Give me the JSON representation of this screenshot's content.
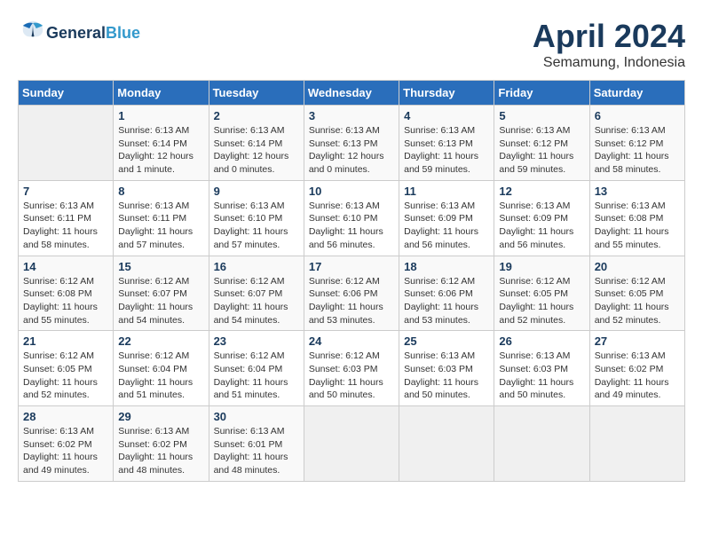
{
  "header": {
    "logo_line1": "General",
    "logo_line2": "Blue",
    "month_title": "April 2024",
    "location": "Semamung, Indonesia"
  },
  "days_of_week": [
    "Sunday",
    "Monday",
    "Tuesday",
    "Wednesday",
    "Thursday",
    "Friday",
    "Saturday"
  ],
  "weeks": [
    [
      {
        "day": null
      },
      {
        "day": "1",
        "sunrise": "Sunrise: 6:13 AM",
        "sunset": "Sunset: 6:14 PM",
        "daylight": "Daylight: 12 hours and 1 minute."
      },
      {
        "day": "2",
        "sunrise": "Sunrise: 6:13 AM",
        "sunset": "Sunset: 6:14 PM",
        "daylight": "Daylight: 12 hours and 0 minutes."
      },
      {
        "day": "3",
        "sunrise": "Sunrise: 6:13 AM",
        "sunset": "Sunset: 6:13 PM",
        "daylight": "Daylight: 12 hours and 0 minutes."
      },
      {
        "day": "4",
        "sunrise": "Sunrise: 6:13 AM",
        "sunset": "Sunset: 6:13 PM",
        "daylight": "Daylight: 11 hours and 59 minutes."
      },
      {
        "day": "5",
        "sunrise": "Sunrise: 6:13 AM",
        "sunset": "Sunset: 6:12 PM",
        "daylight": "Daylight: 11 hours and 59 minutes."
      },
      {
        "day": "6",
        "sunrise": "Sunrise: 6:13 AM",
        "sunset": "Sunset: 6:12 PM",
        "daylight": "Daylight: 11 hours and 58 minutes."
      }
    ],
    [
      {
        "day": "7",
        "sunrise": "Sunrise: 6:13 AM",
        "sunset": "Sunset: 6:11 PM",
        "daylight": "Daylight: 11 hours and 58 minutes."
      },
      {
        "day": "8",
        "sunrise": "Sunrise: 6:13 AM",
        "sunset": "Sunset: 6:11 PM",
        "daylight": "Daylight: 11 hours and 57 minutes."
      },
      {
        "day": "9",
        "sunrise": "Sunrise: 6:13 AM",
        "sunset": "Sunset: 6:10 PM",
        "daylight": "Daylight: 11 hours and 57 minutes."
      },
      {
        "day": "10",
        "sunrise": "Sunrise: 6:13 AM",
        "sunset": "Sunset: 6:10 PM",
        "daylight": "Daylight: 11 hours and 56 minutes."
      },
      {
        "day": "11",
        "sunrise": "Sunrise: 6:13 AM",
        "sunset": "Sunset: 6:09 PM",
        "daylight": "Daylight: 11 hours and 56 minutes."
      },
      {
        "day": "12",
        "sunrise": "Sunrise: 6:13 AM",
        "sunset": "Sunset: 6:09 PM",
        "daylight": "Daylight: 11 hours and 56 minutes."
      },
      {
        "day": "13",
        "sunrise": "Sunrise: 6:13 AM",
        "sunset": "Sunset: 6:08 PM",
        "daylight": "Daylight: 11 hours and 55 minutes."
      }
    ],
    [
      {
        "day": "14",
        "sunrise": "Sunrise: 6:12 AM",
        "sunset": "Sunset: 6:08 PM",
        "daylight": "Daylight: 11 hours and 55 minutes."
      },
      {
        "day": "15",
        "sunrise": "Sunrise: 6:12 AM",
        "sunset": "Sunset: 6:07 PM",
        "daylight": "Daylight: 11 hours and 54 minutes."
      },
      {
        "day": "16",
        "sunrise": "Sunrise: 6:12 AM",
        "sunset": "Sunset: 6:07 PM",
        "daylight": "Daylight: 11 hours and 54 minutes."
      },
      {
        "day": "17",
        "sunrise": "Sunrise: 6:12 AM",
        "sunset": "Sunset: 6:06 PM",
        "daylight": "Daylight: 11 hours and 53 minutes."
      },
      {
        "day": "18",
        "sunrise": "Sunrise: 6:12 AM",
        "sunset": "Sunset: 6:06 PM",
        "daylight": "Daylight: 11 hours and 53 minutes."
      },
      {
        "day": "19",
        "sunrise": "Sunrise: 6:12 AM",
        "sunset": "Sunset: 6:05 PM",
        "daylight": "Daylight: 11 hours and 52 minutes."
      },
      {
        "day": "20",
        "sunrise": "Sunrise: 6:12 AM",
        "sunset": "Sunset: 6:05 PM",
        "daylight": "Daylight: 11 hours and 52 minutes."
      }
    ],
    [
      {
        "day": "21",
        "sunrise": "Sunrise: 6:12 AM",
        "sunset": "Sunset: 6:05 PM",
        "daylight": "Daylight: 11 hours and 52 minutes."
      },
      {
        "day": "22",
        "sunrise": "Sunrise: 6:12 AM",
        "sunset": "Sunset: 6:04 PM",
        "daylight": "Daylight: 11 hours and 51 minutes."
      },
      {
        "day": "23",
        "sunrise": "Sunrise: 6:12 AM",
        "sunset": "Sunset: 6:04 PM",
        "daylight": "Daylight: 11 hours and 51 minutes."
      },
      {
        "day": "24",
        "sunrise": "Sunrise: 6:12 AM",
        "sunset": "Sunset: 6:03 PM",
        "daylight": "Daylight: 11 hours and 50 minutes."
      },
      {
        "day": "25",
        "sunrise": "Sunrise: 6:13 AM",
        "sunset": "Sunset: 6:03 PM",
        "daylight": "Daylight: 11 hours and 50 minutes."
      },
      {
        "day": "26",
        "sunrise": "Sunrise: 6:13 AM",
        "sunset": "Sunset: 6:03 PM",
        "daylight": "Daylight: 11 hours and 50 minutes."
      },
      {
        "day": "27",
        "sunrise": "Sunrise: 6:13 AM",
        "sunset": "Sunset: 6:02 PM",
        "daylight": "Daylight: 11 hours and 49 minutes."
      }
    ],
    [
      {
        "day": "28",
        "sunrise": "Sunrise: 6:13 AM",
        "sunset": "Sunset: 6:02 PM",
        "daylight": "Daylight: 11 hours and 49 minutes."
      },
      {
        "day": "29",
        "sunrise": "Sunrise: 6:13 AM",
        "sunset": "Sunset: 6:02 PM",
        "daylight": "Daylight: 11 hours and 48 minutes."
      },
      {
        "day": "30",
        "sunrise": "Sunrise: 6:13 AM",
        "sunset": "Sunset: 6:01 PM",
        "daylight": "Daylight: 11 hours and 48 minutes."
      },
      {
        "day": null
      },
      {
        "day": null
      },
      {
        "day": null
      },
      {
        "day": null
      }
    ]
  ]
}
